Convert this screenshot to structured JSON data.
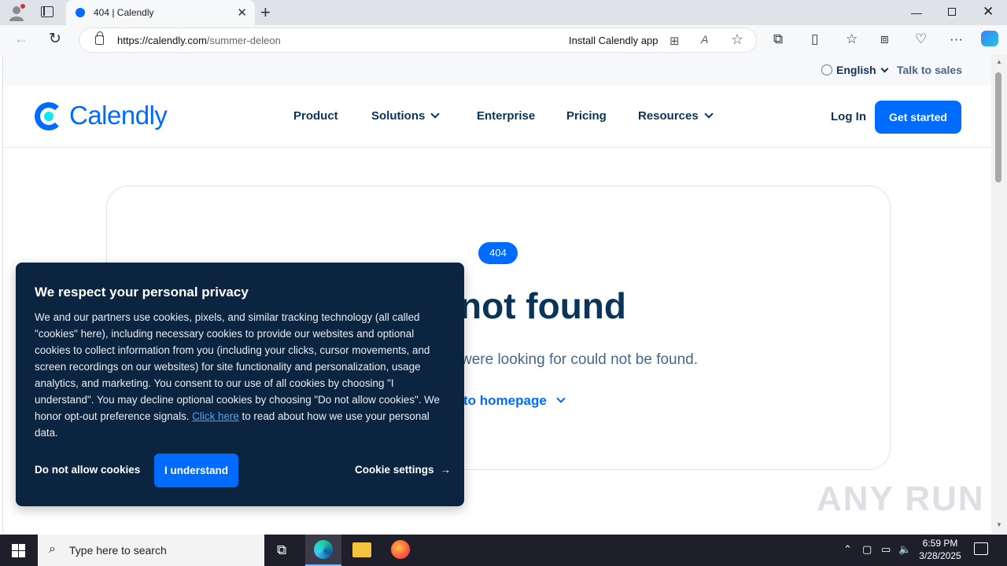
{
  "browser": {
    "tab_title": "404 | Calendly",
    "url_host": "https://calendly.com",
    "url_path": "/summer-deleon",
    "install_app": "Install Calendly app"
  },
  "site": {
    "utility": {
      "language": "English",
      "talk_to_sales": "Talk to sales"
    },
    "logo_text": "Calendly",
    "nav": {
      "product": "Product",
      "solutions": "Solutions",
      "enterprise": "Enterprise",
      "pricing": "Pricing",
      "resources": "Resources",
      "login": "Log In",
      "get_started": "Get started"
    },
    "error": {
      "badge": "404",
      "heading": "not found",
      "subtext": "were looking for could not be found.",
      "home_link": "to homepage"
    }
  },
  "cookie_banner": {
    "title": "We respect your personal privacy",
    "body": "We and our partners use cookies, pixels, and similar tracking technology (all called \"cookies\" here), including necessary cookies to provide our websites and optional cookies to collect information from you (including your clicks, cursor movements, and screen recordings on our websites) for site functionality and personalization, usage analytics, and marketing. You consent to our use of all cookies by choosing \"I understand\". You may decline optional cookies by choosing \"Do not allow cookies\". We honor opt-out preference signals.",
    "link": "Click here",
    "body_end": "to read about how we use your personal data.",
    "deny": "Do not allow cookies",
    "accept": "I understand",
    "settings": "Cookie settings"
  },
  "watermark": "ANY RUN",
  "taskbar": {
    "search_placeholder": "Type here to search",
    "time": "6:59 PM",
    "date": "3/28/2025"
  },
  "colors": {
    "brand": "#006bff",
    "navy": "#0b3558",
    "banner": "#0b2540"
  }
}
